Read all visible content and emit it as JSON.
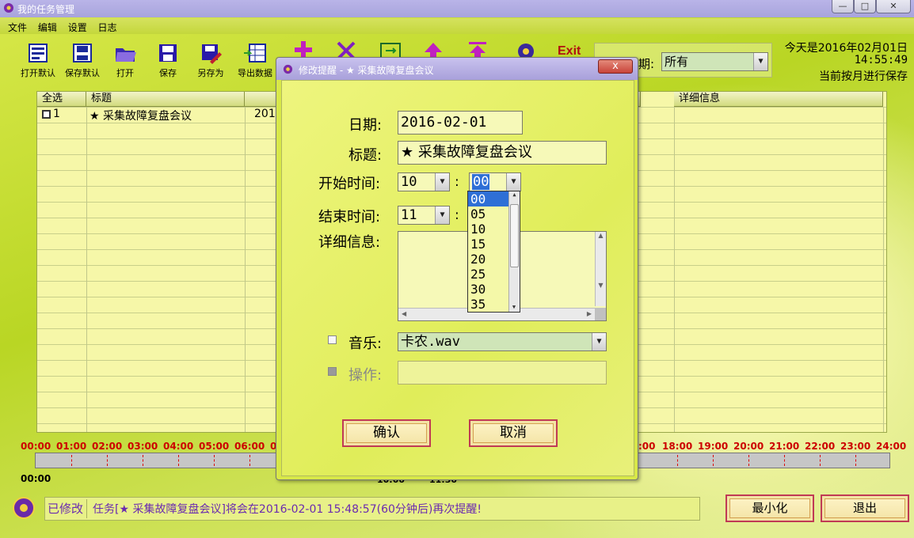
{
  "window": {
    "title": "我的任务管理",
    "min": "—",
    "max": "□",
    "close": "✕"
  },
  "menu": [
    "文件",
    "编辑",
    "设置",
    "日志"
  ],
  "toolbar": [
    {
      "label": "打开默认",
      "icon": "open-default-icon"
    },
    {
      "label": "保存默认",
      "icon": "save-default-icon"
    },
    {
      "label": "打开",
      "icon": "folder-open-icon"
    },
    {
      "label": "保存",
      "icon": "save-disk-icon"
    },
    {
      "label": "另存为",
      "icon": "save-as-icon"
    },
    {
      "label": "导出数据",
      "icon": "export-data-icon"
    }
  ],
  "filter": {
    "label": "期:",
    "value": "所有"
  },
  "clock": {
    "date": "今天是2016年02月01日",
    "time": "14:55:49",
    "mode": "当前按月进行保存"
  },
  "grid": {
    "headers": [
      "全选",
      "标题",
      "",
      "详细信息"
    ],
    "rows": [
      {
        "id": "1",
        "title": "★ 采集故障复盘会议",
        "date": "2016"
      }
    ]
  },
  "timeline": {
    "hours_left": [
      "00:00",
      "01:00",
      "02:00",
      "03:00",
      "04:00",
      "05:00",
      "06:00",
      "0"
    ],
    "hours_right": [
      ":00",
      "18:00",
      "19:00",
      "20:00",
      "21:00",
      "22:00",
      "23:00",
      "24:00"
    ],
    "current": "00:00",
    "hidden_a": "10:00",
    "hidden_b": "11:30"
  },
  "status": {
    "flag": "已修改",
    "message": "任务[★ 采集故障复盘会议]将会在2016-02-01 15:48:57(60分钟后)再次提醒!"
  },
  "buttons": {
    "minimize": "最小化",
    "exit": "退出"
  },
  "dialog": {
    "title": "修改提醒 - ★ 采集故障复盘会议",
    "close": "x",
    "date_label": "日期:",
    "date_value": "2016-02-01",
    "title_label": "标题:",
    "title_value": "★ 采集故障复盘会议",
    "start_label": "开始时间:",
    "start_hour": "10",
    "start_min": "00",
    "end_label": "结束时间:",
    "end_hour": "11",
    "colon": ":",
    "detail_label": "详细信息:",
    "music_label": "音乐:",
    "music_value": "卡农.wav",
    "action_label": "操作:",
    "ok": "确认",
    "cancel": "取消",
    "minute_options": [
      "00",
      "05",
      "10",
      "15",
      "20",
      "25",
      "30",
      "35"
    ]
  },
  "colors": {
    "accent": "#2e6fd6",
    "button_border": "#c03a55",
    "hour_label": "#cc0000"
  }
}
